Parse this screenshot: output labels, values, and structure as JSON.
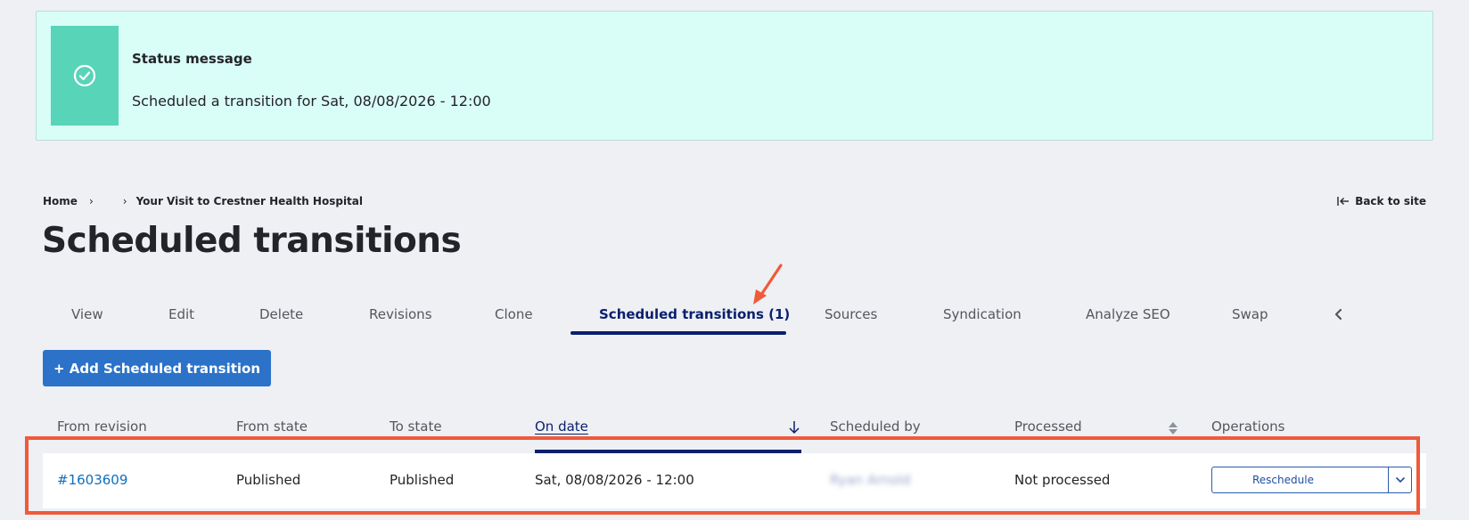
{
  "status": {
    "title": "Status message",
    "text": "Scheduled a transition for Sat, 08/08/2026 - 12:00"
  },
  "breadcrumb": {
    "home": "Home",
    "current": "Your Visit to Crestner Health Hospital"
  },
  "back_to_site": "Back to site",
  "page_title": "Scheduled transitions",
  "tabs": [
    {
      "label": "View"
    },
    {
      "label": "Edit"
    },
    {
      "label": "Delete"
    },
    {
      "label": "Revisions"
    },
    {
      "label": "Clone"
    },
    {
      "label": "Scheduled transitions (1)",
      "active": true
    },
    {
      "label": "Sources"
    },
    {
      "label": "Syndication"
    },
    {
      "label": "Analyze SEO"
    },
    {
      "label": "Swap"
    }
  ],
  "add_button": "+ Add Scheduled transition",
  "table": {
    "headers": [
      "From revision",
      "From state",
      "To state",
      "On date",
      "Scheduled by",
      "Processed",
      "Operations"
    ],
    "sorted_column": "On date",
    "rows": [
      {
        "from_revision": "#1603609",
        "from_state": "Published",
        "to_state": "Published",
        "on_date": "Sat, 08/08/2026 - 12:00",
        "scheduled_by": "Ryan Arnold",
        "processed": "Not processed",
        "operation": "Reschedule"
      }
    ]
  },
  "colors": {
    "status_bg": "#d9fdf7",
    "status_icon_bg": "#58d4b8",
    "primary_button": "#2b72c8",
    "active_tab": "#0a1f6e",
    "link": "#0e6fbe",
    "highlight": "#f0593a"
  },
  "icons": {
    "status": "check-circle-icon",
    "back": "arrow-left-bar-icon",
    "tab_scroll": "chevron-left-icon",
    "sort": "arrow-down-icon",
    "sort_both": "sort-both-icon",
    "dropdown": "chevron-down-icon"
  }
}
